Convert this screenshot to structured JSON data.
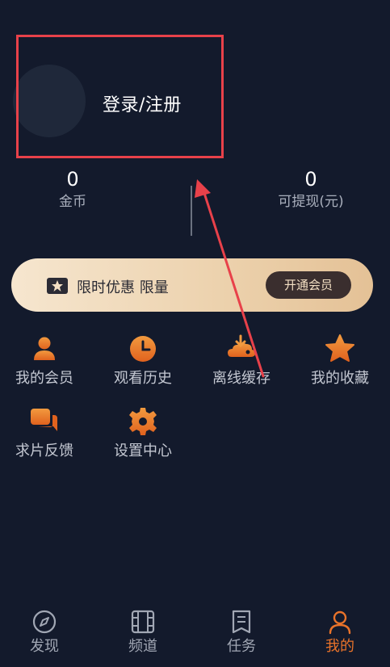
{
  "login": {
    "label": "登录/注册"
  },
  "stats": {
    "coins": {
      "value": "0",
      "label": "金币"
    },
    "cash": {
      "value": "0",
      "label": "可提现(元)"
    }
  },
  "vip": {
    "text": "限时优惠 限量",
    "button": "开通会员"
  },
  "menu": [
    {
      "label": "我的会员",
      "icon": "user-icon"
    },
    {
      "label": "观看历史",
      "icon": "clock-icon"
    },
    {
      "label": "离线缓存",
      "icon": "download-cloud-icon"
    },
    {
      "label": "我的收藏",
      "icon": "star-icon"
    },
    {
      "label": "求片反馈",
      "icon": "chat-icon"
    },
    {
      "label": "设置中心",
      "icon": "gear-icon"
    }
  ],
  "nav": [
    {
      "label": "发现",
      "icon": "compass-icon"
    },
    {
      "label": "频道",
      "icon": "film-icon"
    },
    {
      "label": "任务",
      "icon": "task-icon"
    },
    {
      "label": "我的",
      "icon": "profile-icon",
      "active": true
    }
  ],
  "colors": {
    "accent": "#e9732a",
    "background": "#131a2c",
    "annotation": "#e8414a"
  }
}
